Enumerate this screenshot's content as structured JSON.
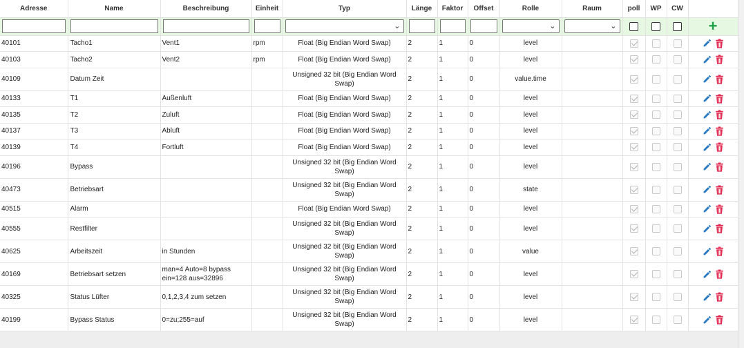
{
  "columns": [
    "Adresse",
    "Name",
    "Beschreibung",
    "Einheit",
    "Typ",
    "Länge",
    "Faktor",
    "Offset",
    "Rolle",
    "Raum",
    "poll",
    "WP",
    "CW"
  ],
  "filter": {
    "adresse": "",
    "name": "",
    "beschreibung": "",
    "einheit": "",
    "typ": "",
    "laenge": "",
    "faktor": "",
    "offset": "",
    "rolle": "",
    "raum": "",
    "add_icon": "plus-icon",
    "add_color": "#1ea046"
  },
  "rows": [
    {
      "adresse": "40101",
      "name": "Tacho1",
      "beschreibung": "Vent1",
      "einheit": "rpm",
      "typ": "Float (Big Endian Word Swap)",
      "laenge": "2",
      "faktor": "1",
      "offset": "0",
      "rolle": "level",
      "raum": "",
      "poll": true,
      "wp": false,
      "cw": false
    },
    {
      "adresse": "40103",
      "name": "Tacho2",
      "beschreibung": "Vent2",
      "einheit": "rpm",
      "typ": "Float (Big Endian Word Swap)",
      "laenge": "2",
      "faktor": "1",
      "offset": "0",
      "rolle": "level",
      "raum": "",
      "poll": true,
      "wp": false,
      "cw": false
    },
    {
      "adresse": "40109",
      "name": "Datum Zeit",
      "beschreibung": "",
      "einheit": "",
      "typ": "Unsigned 32 bit (Big Endian Word Swap)",
      "laenge": "2",
      "faktor": "1",
      "offset": "0",
      "rolle": "value.time",
      "raum": "",
      "poll": true,
      "wp": false,
      "cw": false
    },
    {
      "adresse": "40133",
      "name": "T1",
      "beschreibung": "Außenluft",
      "einheit": "",
      "typ": "Float (Big Endian Word Swap)",
      "laenge": "2",
      "faktor": "1",
      "offset": "0",
      "rolle": "level",
      "raum": "",
      "poll": true,
      "wp": false,
      "cw": false
    },
    {
      "adresse": "40135",
      "name": "T2",
      "beschreibung": "Zuluft",
      "einheit": "",
      "typ": "Float (Big Endian Word Swap)",
      "laenge": "2",
      "faktor": "1",
      "offset": "0",
      "rolle": "level",
      "raum": "",
      "poll": true,
      "wp": false,
      "cw": false
    },
    {
      "adresse": "40137",
      "name": "T3",
      "beschreibung": "Abluft",
      "einheit": "",
      "typ": "Float (Big Endian Word Swap)",
      "laenge": "2",
      "faktor": "1",
      "offset": "0",
      "rolle": "level",
      "raum": "",
      "poll": true,
      "wp": false,
      "cw": false
    },
    {
      "adresse": "40139",
      "name": "T4",
      "beschreibung": "Fortluft",
      "einheit": "",
      "typ": "Float (Big Endian Word Swap)",
      "laenge": "2",
      "faktor": "1",
      "offset": "0",
      "rolle": "level",
      "raum": "",
      "poll": true,
      "wp": false,
      "cw": false
    },
    {
      "adresse": "40196",
      "name": "Bypass",
      "beschreibung": "",
      "einheit": "",
      "typ": "Unsigned 32 bit (Big Endian Word Swap)",
      "laenge": "2",
      "faktor": "1",
      "offset": "0",
      "rolle": "level",
      "raum": "",
      "poll": true,
      "wp": false,
      "cw": false
    },
    {
      "adresse": "40473",
      "name": "Betriebsart",
      "beschreibung": "",
      "einheit": "",
      "typ": "Unsigned 32 bit (Big Endian Word Swap)",
      "laenge": "2",
      "faktor": "1",
      "offset": "0",
      "rolle": "state",
      "raum": "",
      "poll": true,
      "wp": false,
      "cw": false
    },
    {
      "adresse": "40515",
      "name": "Alarm",
      "beschreibung": "",
      "einheit": "",
      "typ": "Float (Big Endian Word Swap)",
      "laenge": "2",
      "faktor": "1",
      "offset": "0",
      "rolle": "level",
      "raum": "",
      "poll": true,
      "wp": false,
      "cw": false
    },
    {
      "adresse": "40555",
      "name": "Restfilter",
      "beschreibung": "",
      "einheit": "",
      "typ": "Unsigned 32 bit (Big Endian Word Swap)",
      "laenge": "2",
      "faktor": "1",
      "offset": "0",
      "rolle": "level",
      "raum": "",
      "poll": true,
      "wp": false,
      "cw": false
    },
    {
      "adresse": "40625",
      "name": "Arbeitszeit",
      "beschreibung": "in Stunden",
      "einheit": "",
      "typ": "Unsigned 32 bit (Big Endian Word Swap)",
      "laenge": "2",
      "faktor": "1",
      "offset": "0",
      "rolle": "value",
      "raum": "",
      "poll": true,
      "wp": false,
      "cw": false
    },
    {
      "adresse": "40169",
      "name": "Betriebsart setzen",
      "beschreibung": "man=4 Auto=8 bypass ein=128 aus=32896",
      "einheit": "",
      "typ": "Unsigned 32 bit (Big Endian Word Swap)",
      "laenge": "2",
      "faktor": "1",
      "offset": "0",
      "rolle": "level",
      "raum": "",
      "poll": true,
      "wp": false,
      "cw": false
    },
    {
      "adresse": "40325",
      "name": "Status Lüfter",
      "beschreibung": "0,1,2,3,4 zum setzen",
      "einheit": "",
      "typ": "Unsigned 32 bit (Big Endian Word Swap)",
      "laenge": "2",
      "faktor": "1",
      "offset": "0",
      "rolle": "level",
      "raum": "",
      "poll": true,
      "wp": false,
      "cw": false
    },
    {
      "adresse": "40199",
      "name": "Bypass Status",
      "beschreibung": "0=zu;255=auf",
      "einheit": "",
      "typ": "Unsigned 32 bit (Big Endian Word Swap)",
      "laenge": "2",
      "faktor": "1",
      "offset": "0",
      "rolle": "level",
      "raum": "",
      "poll": true,
      "wp": false,
      "cw": false
    }
  ],
  "row_actions": {
    "edit_icon": "pencil-icon",
    "edit_color": "#2979c2",
    "delete_icon": "trash-icon",
    "delete_color": "#e2264d"
  }
}
